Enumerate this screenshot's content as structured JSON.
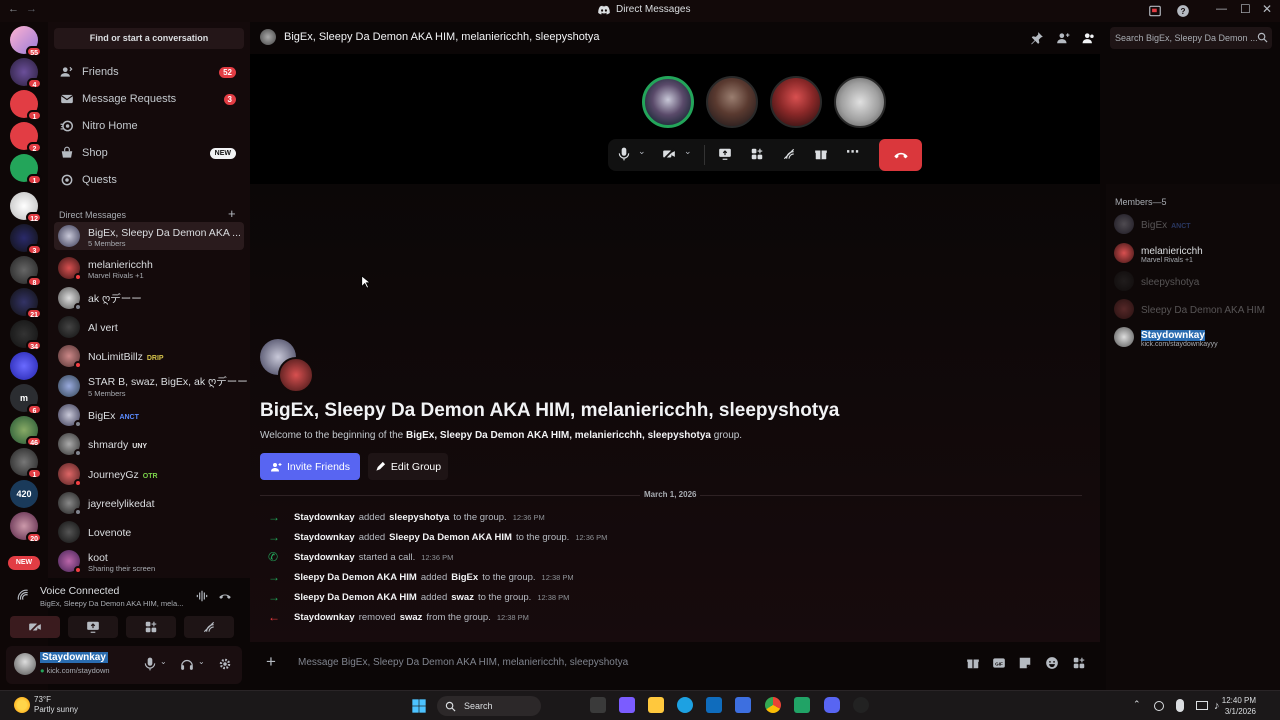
{
  "window": {
    "title": "Direct Messages"
  },
  "servers": [
    {
      "badge": "55"
    },
    {
      "badge": "4"
    },
    {
      "badge": "1"
    },
    {
      "badge": "2"
    },
    {
      "badge": "1"
    },
    {
      "badge": "12"
    },
    {
      "badge": "3"
    },
    {
      "badge": "8"
    },
    {
      "badge": "21"
    },
    {
      "badge": "34"
    },
    {
      "badge": ""
    },
    {
      "badge": "6",
      "label": "m"
    },
    {
      "badge": "46"
    },
    {
      "badge": "1"
    },
    {
      "badge": "",
      "label": "420"
    },
    {
      "badge": "20"
    }
  ],
  "rail": {
    "new_label": "NEW"
  },
  "sidebar": {
    "find": "Find or start a conversation",
    "nav": [
      {
        "label": "Friends",
        "count": "52"
      },
      {
        "label": "Message Requests",
        "count": "3"
      },
      {
        "label": "Nitro Home",
        "count": ""
      },
      {
        "label": "Shop",
        "new": "NEW"
      },
      {
        "label": "Quests",
        "count": ""
      }
    ],
    "dm_header": "Direct Messages",
    "dms": [
      {
        "name": "BigEx, Sleepy Da Demon AKA ...",
        "sub": "5 Members",
        "tag": ""
      },
      {
        "name": "melaniericchh",
        "sub": "Marvel Rivals +1",
        "tag": ""
      },
      {
        "name": "ak ღデーー",
        "sub": "",
        "tag": ""
      },
      {
        "name": "Al vert",
        "sub": "",
        "tag": ""
      },
      {
        "name": "NoLimitBillz",
        "sub": "",
        "tag": "DRIP"
      },
      {
        "name": "STAR B, swaz, BigEx, ak ღデーー",
        "sub": "5 Members",
        "tag": ""
      },
      {
        "name": "BigEx",
        "sub": "",
        "tag": "ANCT"
      },
      {
        "name": "shmardy",
        "sub": "",
        "tag": "UNY"
      },
      {
        "name": "JourneyGz",
        "sub": "",
        "tag": "OTR"
      },
      {
        "name": "jayreelylikedat",
        "sub": "",
        "tag": ""
      },
      {
        "name": "Lovenote",
        "sub": "",
        "tag": ""
      },
      {
        "name": "koot",
        "sub": "Sharing their screen",
        "tag": ""
      }
    ]
  },
  "voice": {
    "title": "Voice Connected",
    "sub": "BigEx, Sleepy Da Demon AKA HIM, mela..."
  },
  "user": {
    "name": "Staydownkay",
    "status": "kick.com/staydown"
  },
  "channel": {
    "title": "BigEx, Sleepy Da Demon AKA HIM, melaniericchh, sleepyshotya",
    "search_placeholder": "Search BigEx, Sleepy Da Demon ..."
  },
  "chat": {
    "group_title": "BigEx, Sleepy Da Demon AKA HIM, melaniericchh, sleepyshotya",
    "welcome_prefix": "Welcome to the beginning of the",
    "welcome_group": "BigEx, Sleepy Da Demon AKA HIM, melaniericchh, sleepyshotya",
    "welcome_suffix": "group.",
    "invite_label": "Invite Friends",
    "edit_label": "Edit Group",
    "date": "March 1, 2026",
    "messages": [
      {
        "icon": "→",
        "actor": "Staydownkay",
        "verb": "added",
        "target": "sleepyshotya",
        "rest": "to the group.",
        "time": "12:36 PM",
        "color": "#23a55a"
      },
      {
        "icon": "→",
        "actor": "Staydownkay",
        "verb": "added",
        "target": "Sleepy Da Demon AKA HIM",
        "rest": "to the group.",
        "time": "12:36 PM",
        "color": "#23a55a"
      },
      {
        "icon": "✆",
        "actor": "Staydownkay",
        "verb": "started a call.",
        "target": "",
        "rest": "",
        "time": "12:36 PM",
        "color": "#23a55a"
      },
      {
        "icon": "→",
        "actor": "Sleepy Da Demon AKA HIM",
        "verb": "added",
        "target": "BigEx",
        "rest": "to the group.",
        "time": "12:38 PM",
        "color": "#23a55a"
      },
      {
        "icon": "→",
        "actor": "Sleepy Da Demon AKA HIM",
        "verb": "added",
        "target": "swaz",
        "rest": "to the group.",
        "time": "12:38 PM",
        "color": "#23a55a"
      },
      {
        "icon": "←",
        "actor": "Staydownkay",
        "verb": "removed",
        "target": "swaz",
        "rest": "from the group.",
        "time": "12:38 PM",
        "color": "#f23f43"
      }
    ],
    "composer_placeholder": "Message BigEx, Sleepy Da Demon AKA HIM, melaniericchh, sleepyshotya"
  },
  "members": {
    "header": "Members—5",
    "list": [
      {
        "name": "BigEx",
        "tag": "ANCT",
        "sub": "",
        "offline": true
      },
      {
        "name": "melaniericchh",
        "tag": "",
        "sub": "Marvel Rivals +1",
        "offline": false
      },
      {
        "name": "sleepyshotya",
        "tag": "",
        "sub": "",
        "offline": true
      },
      {
        "name": "Sleepy Da Demon AKA HIM",
        "tag": "",
        "sub": "",
        "offline": true
      },
      {
        "name": "Staydownkay",
        "tag": "",
        "sub": "kick.com/staydownkayyy",
        "offline": false
      }
    ]
  },
  "taskbar": {
    "temp": "73°F",
    "weather": "Partly sunny",
    "search": "Search",
    "time": "12:40 PM",
    "date": "3/1/2026"
  },
  "colors": {
    "accent": "#5865f2",
    "danger": "#da373c",
    "online": "#23a55a"
  }
}
